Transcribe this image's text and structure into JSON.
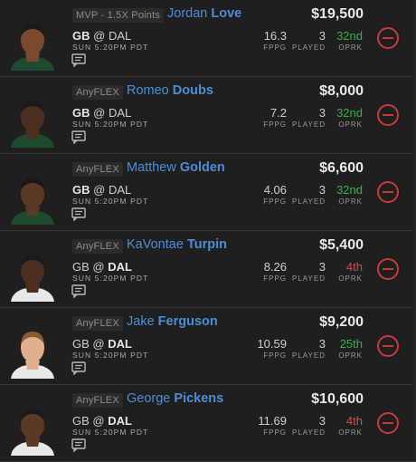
{
  "players": [
    {
      "slot": "MVP - 1.5X Points",
      "first": "Jordan",
      "last": "Love",
      "team": "GB",
      "at": "@",
      "opp": "DAL",
      "bold": "team",
      "time": "SUN 5:20PM PDT",
      "salary": "$19,500",
      "fppg": "16.3",
      "played": "3",
      "oprk": "32nd",
      "oprk_color": "green",
      "fppg_label": "FPPG",
      "played_label": "PLAYED",
      "oprk_label": "OPRK",
      "skin": "#7a4a2e",
      "jersey": "#1e4a2e",
      "hair": "#1a1a1a"
    },
    {
      "slot": "AnyFLEX",
      "first": "Romeo",
      "last": "Doubs",
      "team": "GB",
      "at": "@",
      "opp": "DAL",
      "bold": "team",
      "time": "SUN 5:20PM PDT",
      "salary": "$8,000",
      "fppg": "7.2",
      "played": "3",
      "oprk": "32nd",
      "oprk_color": "green",
      "fppg_label": "FPPG",
      "played_label": "PLAYED",
      "oprk_label": "OPRK",
      "skin": "#4a2e1e",
      "jersey": "#1e4a2e",
      "hair": "#1a1a1a"
    },
    {
      "slot": "AnyFLEX",
      "first": "Matthew",
      "last": "Golden",
      "team": "GB",
      "at": "@",
      "opp": "DAL",
      "bold": "team",
      "time": "SUN 5:20PM PDT",
      "salary": "$6,600",
      "fppg": "4.06",
      "played": "3",
      "oprk": "32nd",
      "oprk_color": "green",
      "fppg_label": "FPPG",
      "played_label": "PLAYED",
      "oprk_label": "OPRK",
      "skin": "#5a3a26",
      "jersey": "#1e4a2e",
      "hair": "#1a1a1a"
    },
    {
      "slot": "AnyFLEX",
      "first": "KaVontae",
      "last": "Turpin",
      "team": "GB",
      "at": "@",
      "opp": "DAL",
      "bold": "opp",
      "time": "SUN 5:20PM PDT",
      "salary": "$5,400",
      "fppg": "8.26",
      "played": "3",
      "oprk": "4th",
      "oprk_color": "red",
      "fppg_label": "FPPG",
      "played_label": "PLAYED",
      "oprk_label": "OPRK",
      "skin": "#4a2e1e",
      "jersey": "#e8e8e8",
      "hair": "#1a1a1a"
    },
    {
      "slot": "AnyFLEX",
      "first": "Jake",
      "last": "Ferguson",
      "team": "GB",
      "at": "@",
      "opp": "DAL",
      "bold": "opp",
      "time": "SUN 5:20PM PDT",
      "salary": "$9,200",
      "fppg": "10.59",
      "played": "3",
      "oprk": "25th",
      "oprk_color": "green",
      "fppg_label": "FPPG",
      "played_label": "PLAYED",
      "oprk_label": "OPRK",
      "skin": "#e0b08e",
      "jersey": "#e8e8e8",
      "hair": "#8a5a36"
    },
    {
      "slot": "AnyFLEX",
      "first": "George",
      "last": "Pickens",
      "team": "GB",
      "at": "@",
      "opp": "DAL",
      "bold": "opp",
      "time": "SUN 5:20PM PDT",
      "salary": "$10,600",
      "fppg": "11.69",
      "played": "3",
      "oprk": "4th",
      "oprk_color": "red",
      "fppg_label": "FPPG",
      "played_label": "PLAYED",
      "oprk_label": "OPRK",
      "skin": "#5a3a26",
      "jersey": "#e8e8e8",
      "hair": "#1a1a1a"
    }
  ],
  "icons": {
    "notes": "notes-icon",
    "remove": "remove-player-icon"
  },
  "colors": {
    "name_blue": "#4a8fd6",
    "oprk_green": "#33b24a",
    "oprk_red": "#e04848",
    "remove_red": "#c83a3a"
  }
}
